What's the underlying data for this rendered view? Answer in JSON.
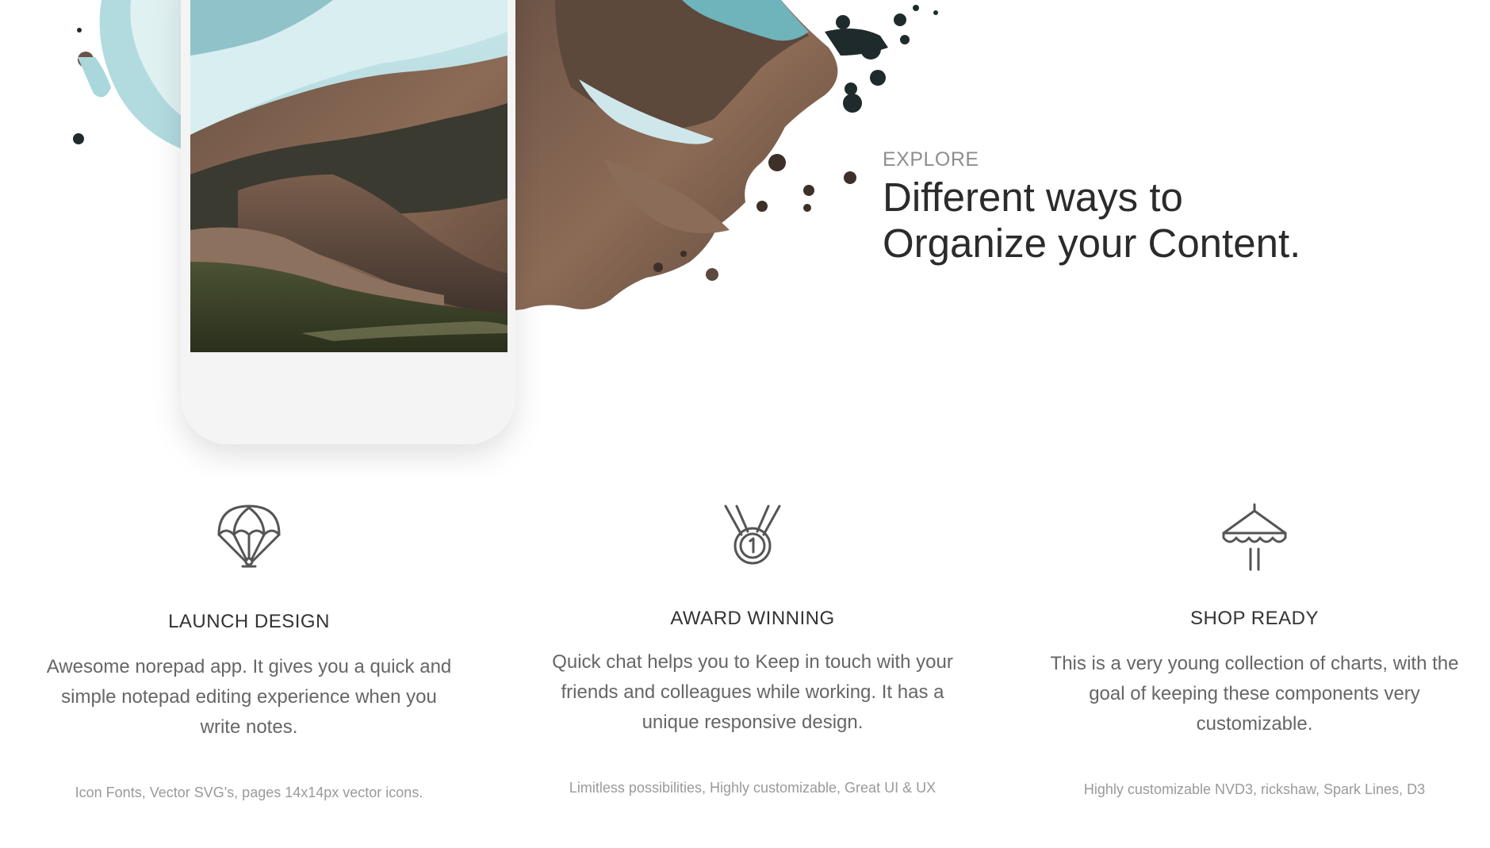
{
  "explore": {
    "eyebrow": "EXPLORE",
    "title_line1": "Different ways to",
    "title_line2": "Organize your Content."
  },
  "features": [
    {
      "icon": "parachute-icon",
      "title": "LAUNCH DESIGN",
      "description": "Awesome norepad app. It gives you a quick and simple notepad editing experience when you write notes.",
      "meta": "Icon Fonts, Vector SVG's, pages 14x14px vector icons."
    },
    {
      "icon": "medal-icon",
      "title": "AWARD WINNING",
      "description": "Quick chat helps you to Keep in touch with your friends and colleagues while working. It has a unique responsive design.",
      "meta": "Limitless possibilities, Highly customizable, Great UI & UX"
    },
    {
      "icon": "market-stall-icon",
      "title": "SHOP READY",
      "description": "This is a very young collection of charts, with the goal of keeping these components very customizable.",
      "meta": "Highly customizable NVD3, rickshaw, Spark Lines, D3"
    }
  ],
  "colors": {
    "heading": "#2b2b2b",
    "eyebrow": "#8e8e8e",
    "body_text": "#666666",
    "meta_text": "#9a9a9a",
    "splash_teal": "#a9d7dc",
    "ink": "#1f2a2c"
  }
}
